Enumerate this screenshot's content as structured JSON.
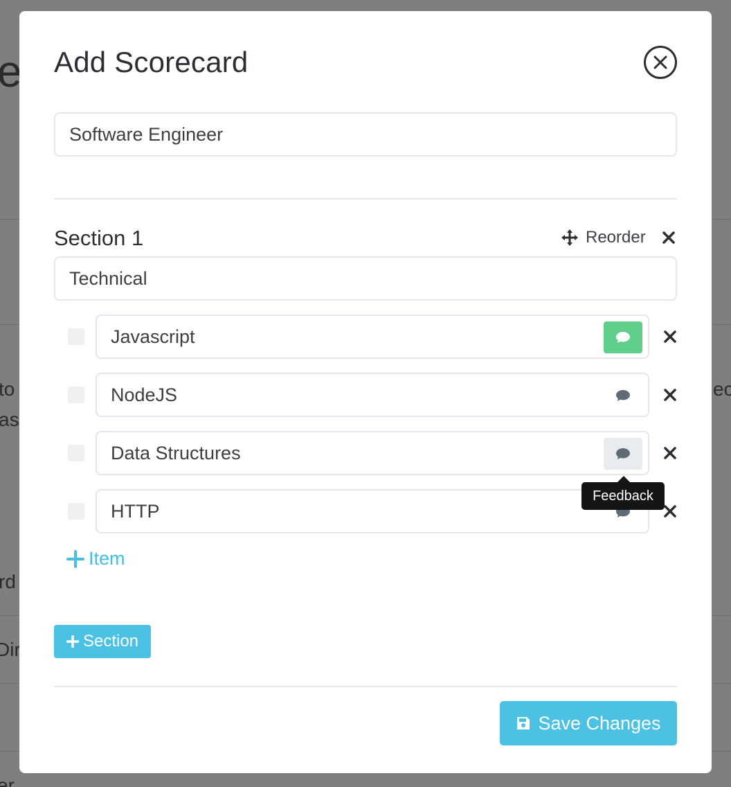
{
  "background": {
    "fragments": [
      "es",
      "to",
      "as i",
      "rd",
      "Dir",
      "er",
      "eca"
    ]
  },
  "modal": {
    "title": "Add Scorecard",
    "close_icon": "close-circle-icon",
    "scorecard_name": "Software Engineer"
  },
  "section": {
    "title": "Section 1",
    "reorder_label": "Reorder",
    "name_value": "Technical",
    "items": [
      {
        "label": "Javascript",
        "feedback_state": "active"
      },
      {
        "label": "NodeJS",
        "feedback_state": "default"
      },
      {
        "label": "Data Structures",
        "feedback_state": "hover"
      },
      {
        "label": "HTTP",
        "feedback_state": "default"
      }
    ],
    "add_item_label": "Item"
  },
  "tooltip": "Feedback",
  "footer": {
    "add_section_label": "Section",
    "save_label": "Save Changes"
  },
  "colors": {
    "accent": "#4bc1e3",
    "feedback_active": "#5fcf8b",
    "overlay": "#7f7f7f"
  }
}
